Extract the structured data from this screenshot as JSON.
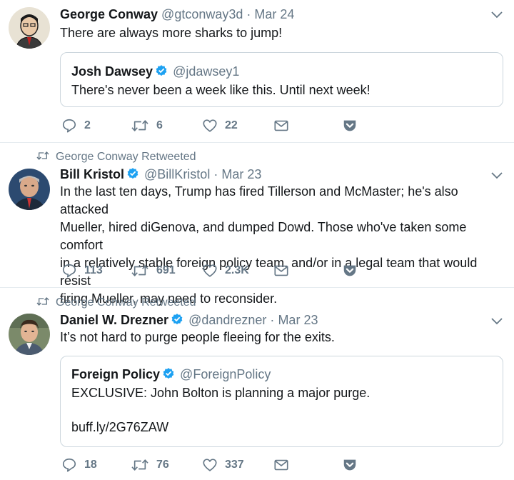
{
  "tweets": [
    {
      "author": {
        "name": "George Conway",
        "handle": "@gtconway3d",
        "verified": false
      },
      "date": "Mar 24",
      "text": "There are always more sharks to jump!",
      "quote": {
        "author": {
          "name": "Josh Dawsey",
          "handle": "@jdawsey1",
          "verified": true
        },
        "text": "There's never been a week like this. Until next week!"
      },
      "actions": {
        "replies": "2",
        "retweets": "6",
        "likes": "22"
      }
    },
    {
      "retweeted_by": "George Conway Retweeted",
      "author": {
        "name": "Bill Kristol",
        "handle": "@BillKristol",
        "verified": true
      },
      "date": "Mar 23",
      "text_lines": [
        "In the last ten days, Trump has fired Tillerson and McMaster; he's also attacked",
        "Mueller, hired diGenova, and dumped Dowd. Those who've taken some comfort",
        "in a relatively stable foreign policy team, and/or in a legal team that would resist",
        "firing Mueller, may need to reconsider."
      ],
      "actions": {
        "replies": "113",
        "retweets": "691",
        "likes": "2.3K"
      }
    },
    {
      "retweeted_by": "George Conway Retweeted",
      "author": {
        "name": "Daniel W. Drezner",
        "handle": "@dandrezner",
        "verified": true
      },
      "date": "Mar 23",
      "text": "It’s not hard to purge people fleeing for the exits.",
      "quote": {
        "author": {
          "name": "Foreign Policy",
          "handle": "@ForeignPolicy",
          "verified": true
        },
        "text": "EXCLUSIVE: John Bolton is planning a major purge.",
        "link": "buff.ly/2G76ZAW"
      },
      "actions": {
        "replies": "18",
        "retweets": "76",
        "likes": "337"
      }
    }
  ],
  "separator": "·",
  "colors": {
    "verified": "#1da1f2",
    "muted": "#657786",
    "border": "#e6ecf0",
    "quote_border": "#ccd6dd"
  },
  "icons": {
    "reply": "reply-icon",
    "retweet": "retweet-icon",
    "like": "heart-icon",
    "dm": "envelope-icon",
    "save": "pocket-icon",
    "caret": "chevron-down-icon",
    "verified": "verified-badge-icon"
  }
}
